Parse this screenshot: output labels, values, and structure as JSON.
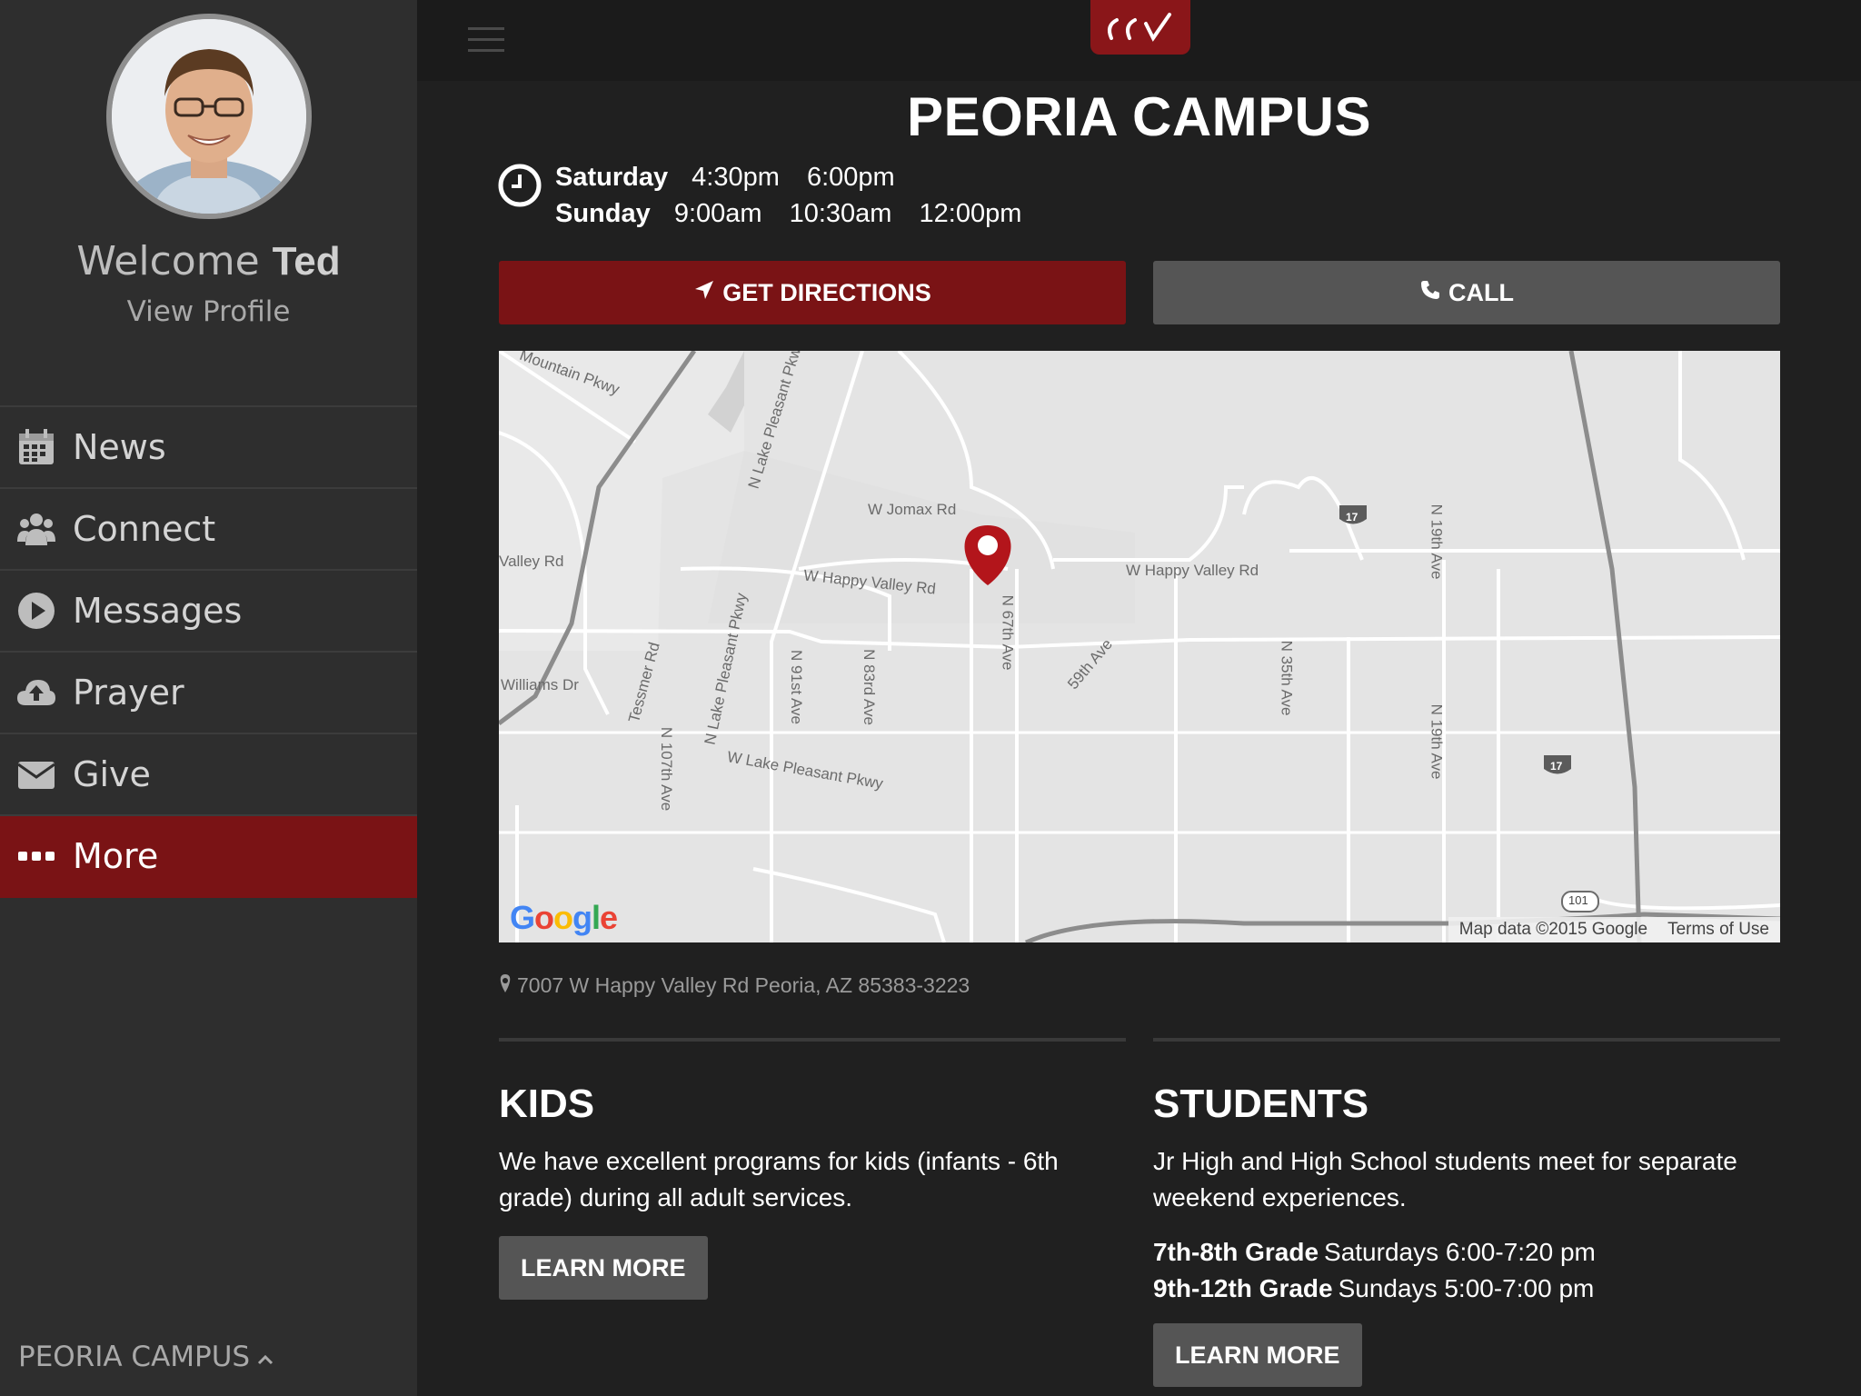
{
  "sidebar": {
    "welcome": "Welcome",
    "user_name": "Ted",
    "view_profile": "View Profile",
    "items": [
      {
        "label": "News",
        "icon": "calendar-icon"
      },
      {
        "label": "Connect",
        "icon": "people-icon"
      },
      {
        "label": "Messages",
        "icon": "play-circle-icon"
      },
      {
        "label": "Prayer",
        "icon": "cloud-upload-icon"
      },
      {
        "label": "Give",
        "icon": "envelope-icon"
      },
      {
        "label": "More",
        "icon": "ellipsis-icon"
      }
    ],
    "active_item": "More",
    "campus_switcher": "PEORIA CAMPUS"
  },
  "header": {
    "logo_text": "ccv",
    "menu_icon": "hamburger-icon"
  },
  "campus": {
    "title": "PEORIA CAMPUS",
    "times": {
      "saturday": {
        "day": "Saturday",
        "times": [
          "4:30pm",
          "6:00pm"
        ]
      },
      "sunday": {
        "day": "Sunday",
        "times": [
          "9:00am",
          "10:30am",
          "12:00pm"
        ]
      }
    },
    "directions_label": "GET DIRECTIONS",
    "call_label": "CALL",
    "address": "7007 W Happy Valley Rd Peoria, AZ 85383-3223"
  },
  "map": {
    "streets": {
      "mountain_pkwy": "Mountain Pkwy",
      "lake_pleasant_pkwy_n1": "N Lake Pleasant Pkwy",
      "jomax": "W Jomax Rd",
      "valley_rd": "Valley Rd",
      "happy_valley_w": "W Happy Valley Rd",
      "happy_valley_e": "W Happy Valley Rd",
      "williams": "Williams Dr",
      "tessmer": "Tessmer Rd",
      "lake_pleasant_pkwy_n2": "N Lake Pleasant Pkwy",
      "n91st": "N 91st Ave",
      "n83rd": "N 83rd Ave",
      "n67th": "N 67th Ave",
      "ave59th": "59th Ave",
      "n35th": "N 35th Ave",
      "n19th_a": "N 19th Ave",
      "n19th_b": "N 19th Ave",
      "n107th": "N 107th Ave",
      "w_lake_pleasant": "W Lake Pleasant Pkwy"
    },
    "shields": [
      "17",
      "17",
      "101"
    ],
    "google": "Google",
    "attribution": "Map data ©2015 Google",
    "terms": "Terms of Use"
  },
  "kids": {
    "title": "KIDS",
    "description": "We have excellent programs for kids (infants - 6th grade) during all adult services.",
    "learn_more": "LEARN MORE"
  },
  "students": {
    "title": "STUDENTS",
    "description": "Jr High and High School students meet for separate weekend experiences.",
    "grade1_label": "7th-8th Grade",
    "grade1_time": "Saturdays 6:00-7:20 pm",
    "grade2_label": "9th-12th Grade",
    "grade2_time": "Sundays 5:00-7:00 pm",
    "learn_more": "LEARN MORE"
  },
  "colors": {
    "accent": "#7a1315",
    "sidebar_bg": "#2e2e2e",
    "main_bg": "#202020",
    "secondary_button": "#555555"
  }
}
